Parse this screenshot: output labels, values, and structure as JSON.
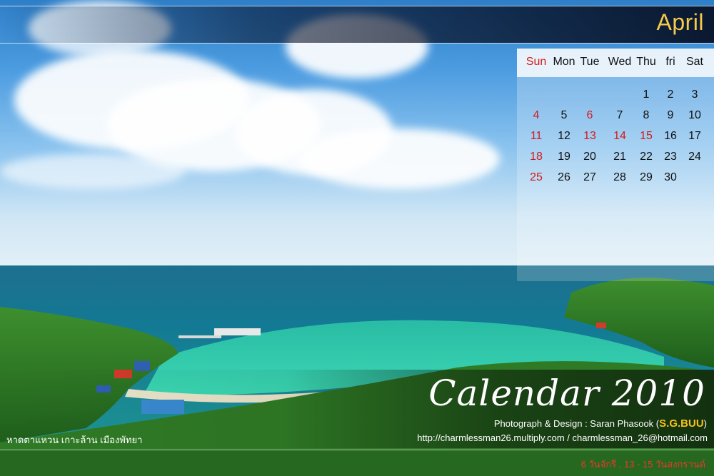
{
  "month": "April",
  "weekdays": [
    "Sun",
    "Mon",
    "Tue",
    "Wed",
    "Thu",
    "fri",
    "Sat"
  ],
  "weeks": [
    [
      "",
      "",
      "",
      "",
      "1",
      "2",
      "3"
    ],
    [
      "4",
      "5",
      "6",
      "7",
      "8",
      "9",
      "10"
    ],
    [
      "11",
      "12",
      "13",
      "14",
      "15",
      "16",
      "17"
    ],
    [
      "18",
      "19",
      "20",
      "21",
      "22",
      "23",
      "24"
    ],
    [
      "25",
      "26",
      "27",
      "28",
      "29",
      "30",
      ""
    ]
  ],
  "red_days": [
    "4",
    "6",
    "11",
    "13",
    "14",
    "15",
    "18",
    "25"
  ],
  "title": "Calendar 2010",
  "credit_prefix": "Photograph & Design : Saran Phasook (",
  "credit_brand": "S.G.BUU",
  "credit_suffix": ")",
  "urls": "http://charmlessman26.multiply.com / charmlessman_26@hotmail.com",
  "place_caption": "หาดตาแหวน  เกาะล้าน  เมืองพัทยา",
  "holiday_note": "6 วันจักรี , 13 - 15 วันสงกรานต์",
  "colors": {
    "month": "#f7c94a",
    "holiday": "#d21c1c",
    "brand": "#f4c21b"
  }
}
